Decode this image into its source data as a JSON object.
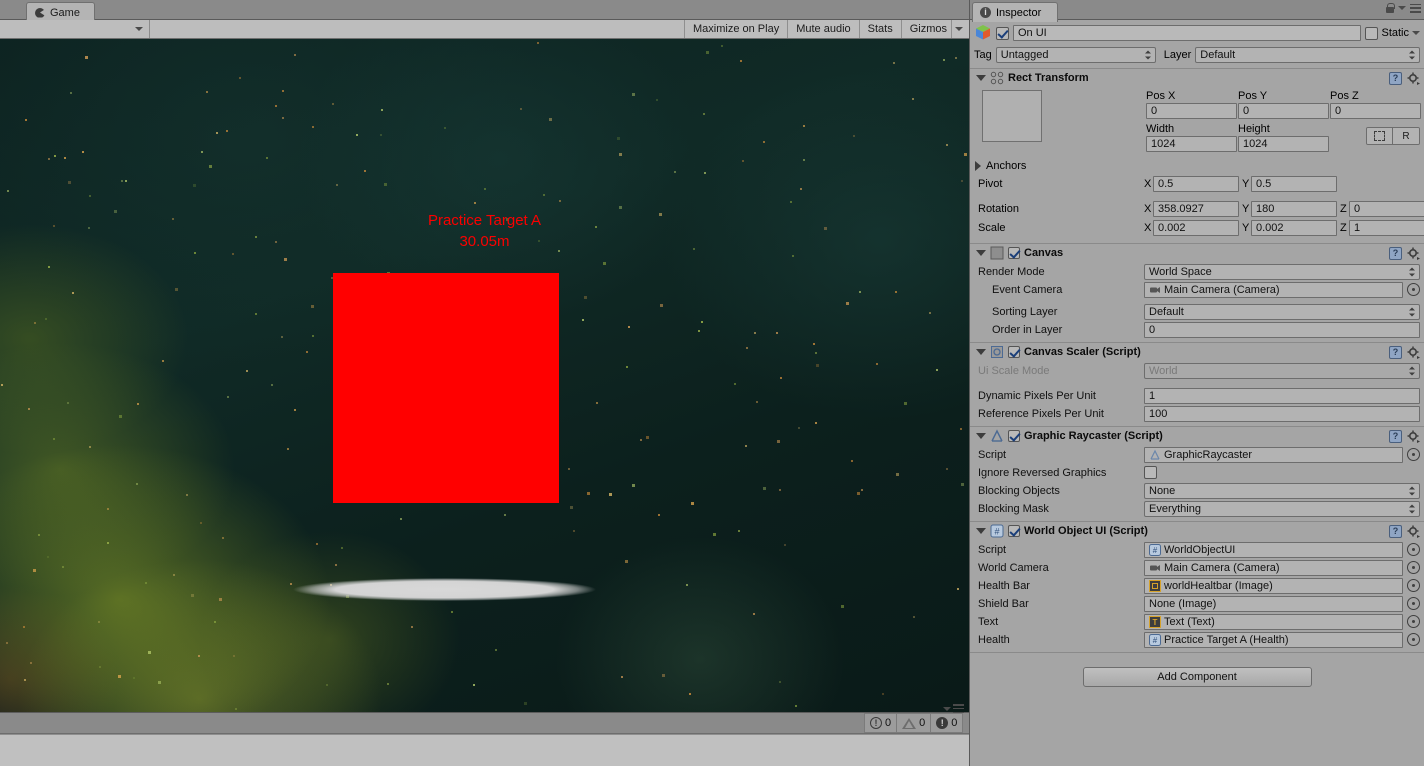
{
  "game_panel": {
    "tab_label": "Game",
    "tab_icon": "pacman-icon",
    "toolbar": {
      "aspect_dropdown": "",
      "maximize_on_play": "Maximize on Play",
      "mute_audio": "Mute audio",
      "stats": "Stats",
      "gizmos": "Gizmos"
    },
    "scene": {
      "target_name": "Practice Target A",
      "target_distance": "30.05m",
      "target_color": "#ff0000",
      "label_color": "#fb0000",
      "health_bar_color": "#d4d4d4"
    },
    "console_counters": {
      "info": "0",
      "warning": "0",
      "error": "0"
    }
  },
  "inspector": {
    "tab_label": "Inspector",
    "tab_icon": "info-icon",
    "lock_icon": "lock-icon",
    "menu_icon": "hamburger-menu-icon",
    "object": {
      "enabled": true,
      "name": "On UI",
      "static_label": "Static",
      "static_checked": false,
      "tag_label": "Tag",
      "tag_value": "Untagged",
      "layer_label": "Layer",
      "layer_value": "Default"
    },
    "components": [
      {
        "title": "Rect Transform",
        "expanded": true,
        "headers": {
          "pos_x": "Pos X",
          "pos_y": "Pos Y",
          "pos_z": "Pos Z",
          "width": "Width",
          "height": "Height"
        },
        "values": {
          "pos_x": "0",
          "pos_y": "0",
          "pos_z": "0",
          "width": "1024",
          "height": "1024"
        },
        "blueprint_button": "blueprint-icon",
        "raw_button": "R",
        "anchors_label": "Anchors",
        "pivot_label": "Pivot",
        "pivot_x": "0.5",
        "pivot_y": "0.5",
        "rotation_label": "Rotation",
        "rotation_x": "358.0927",
        "rotation_y": "180",
        "rotation_z": "0",
        "scale_label": "Scale",
        "scale_x": "0.002",
        "scale_y": "0.002",
        "scale_z": "1",
        "axis_x": "X",
        "axis_y": "Y",
        "axis_z": "Z"
      },
      {
        "title": "Canvas",
        "enabled": true,
        "rows": [
          {
            "label": "Render Mode",
            "value": "World Space",
            "kind": "popup"
          },
          {
            "label": "Event Camera",
            "value": "Main Camera (Camera)",
            "kind": "object",
            "icon": "camera-icon",
            "indent": true
          },
          {
            "label": "Sorting Layer",
            "value": "Default",
            "kind": "popup",
            "indent": true
          },
          {
            "label": "Order in Layer",
            "value": "0",
            "kind": "text",
            "indent": true
          }
        ]
      },
      {
        "title": "Canvas Scaler (Script)",
        "enabled": true,
        "rows": [
          {
            "label": "Ui Scale Mode",
            "value": "World",
            "kind": "popup",
            "dim": true
          },
          {
            "label": "Dynamic Pixels Per Unit",
            "value": "1",
            "kind": "text"
          },
          {
            "label": "Reference Pixels Per Unit",
            "value": "100",
            "kind": "text"
          }
        ]
      },
      {
        "title": "Graphic Raycaster (Script)",
        "enabled": true,
        "rows": [
          {
            "label": "Script",
            "value": "GraphicRaycaster",
            "kind": "object",
            "icon": "script-icon"
          },
          {
            "label": "Ignore Reversed Graphics",
            "value": "",
            "kind": "checkbox",
            "checked": false
          },
          {
            "label": "Blocking Objects",
            "value": "None",
            "kind": "popup"
          },
          {
            "label": "Blocking Mask",
            "value": "Everything",
            "kind": "popup"
          }
        ]
      },
      {
        "title": "World Object UI (Script)",
        "enabled": true,
        "rows": [
          {
            "label": "Script",
            "value": "WorldObjectUI",
            "kind": "object",
            "icon": "csharp-script-icon"
          },
          {
            "label": "World Camera",
            "value": "Main Camera (Camera)",
            "kind": "object",
            "icon": "camera-icon"
          },
          {
            "label": "Health Bar",
            "value": "worldHealtbar (Image)",
            "kind": "object",
            "icon": "image-icon"
          },
          {
            "label": "Shield Bar",
            "value": "None (Image)",
            "kind": "object",
            "icon": "none"
          },
          {
            "label": "Text",
            "value": "Text (Text)",
            "kind": "object",
            "icon": "text-icon"
          },
          {
            "label": "Health",
            "value": "Practice Target A (Health)",
            "kind": "object",
            "icon": "csharp-script-icon"
          }
        ]
      }
    ],
    "add_component_label": "Add Component"
  }
}
